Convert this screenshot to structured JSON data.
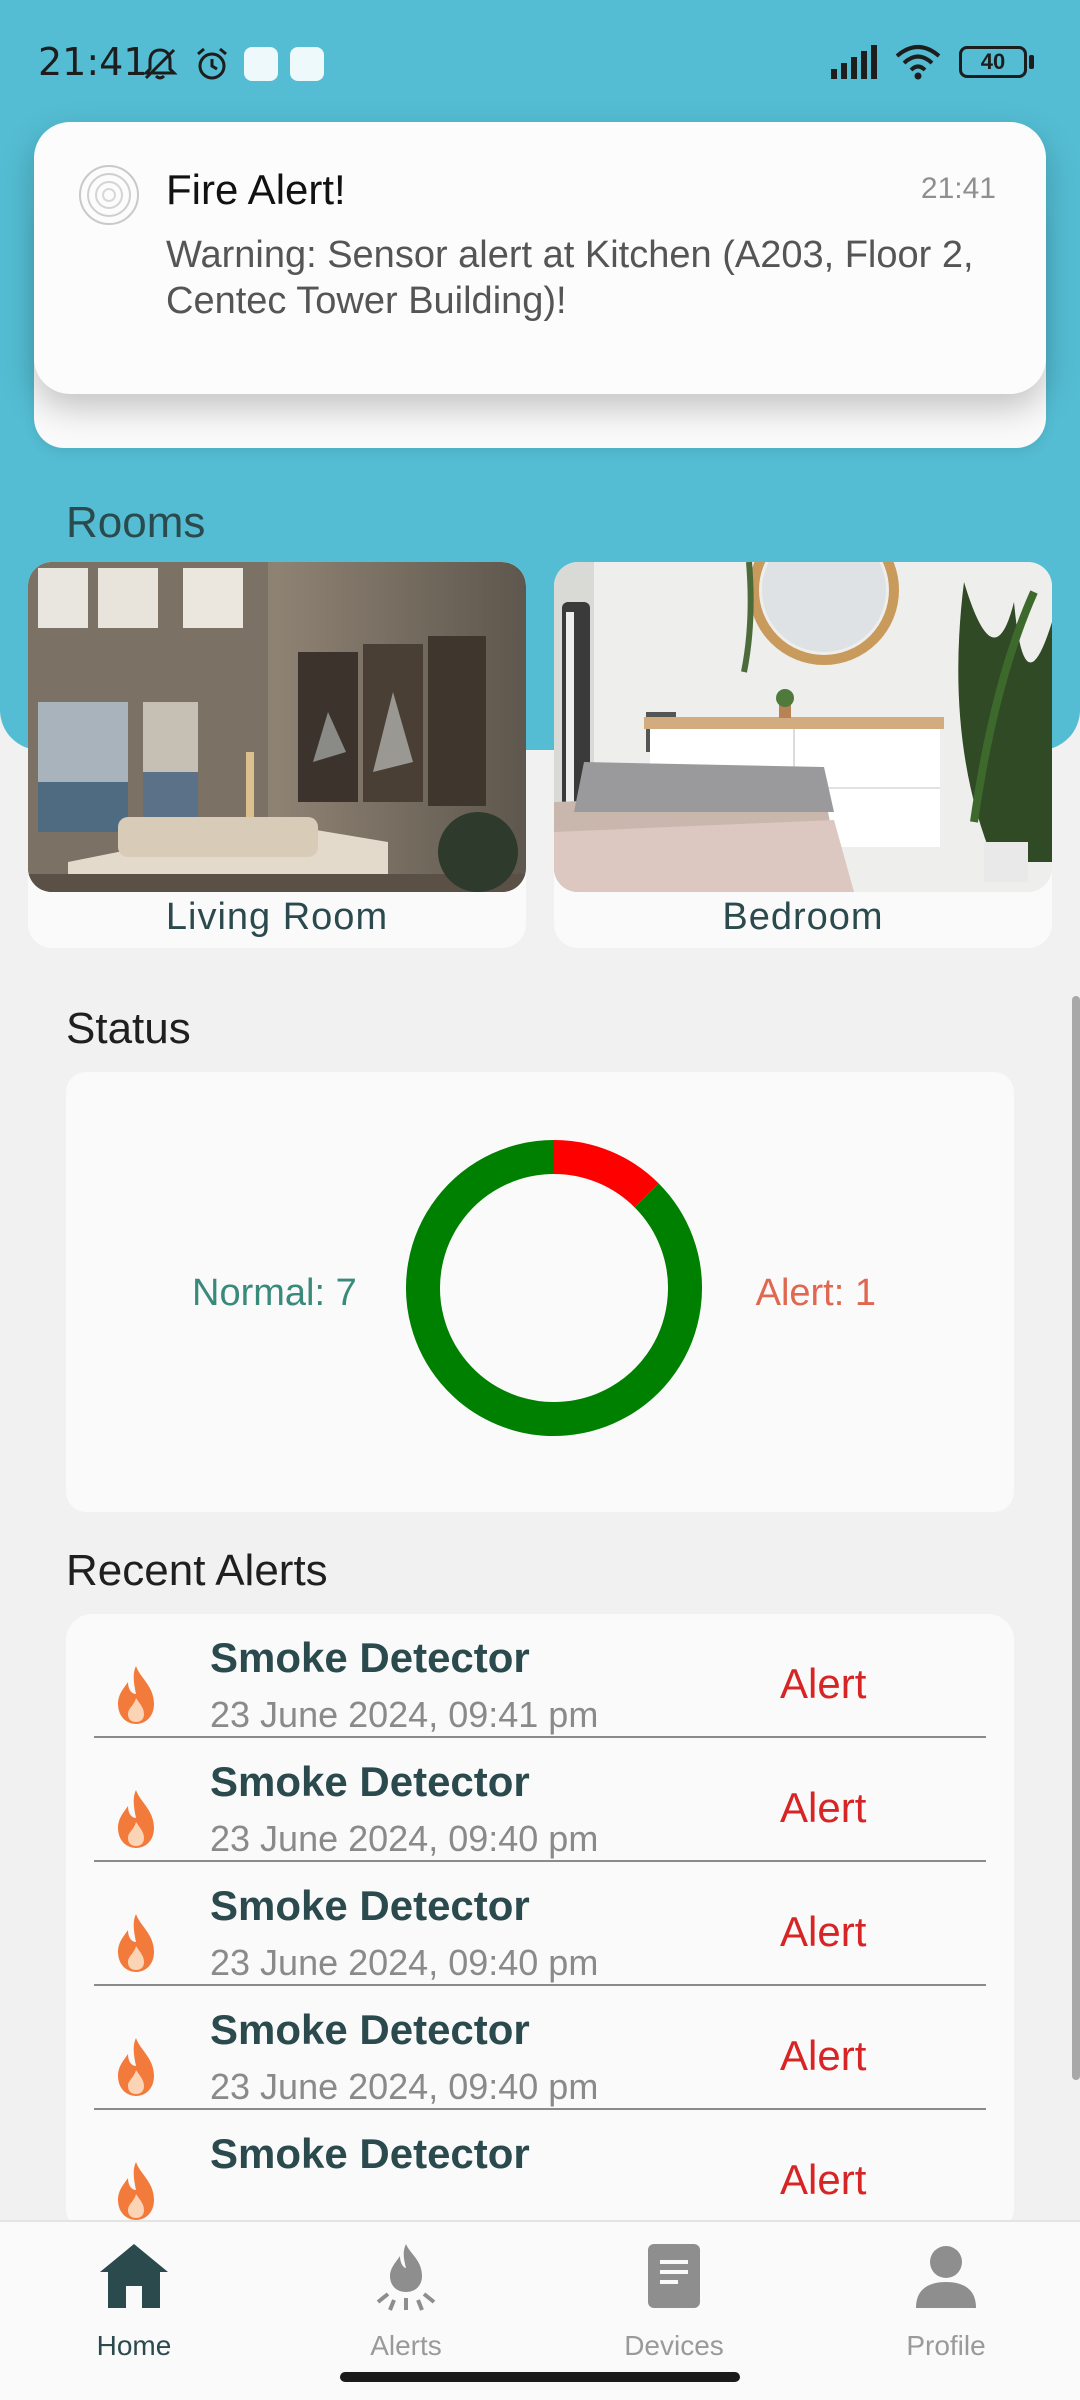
{
  "status_bar": {
    "time": "21:41",
    "battery": "40"
  },
  "notification": {
    "title": "Fire Alert!",
    "time": "21:41",
    "body": "Warning: Sensor alert at Kitchen (A203, Floor 2, Centec Tower Building)!"
  },
  "rooms": {
    "title": "Rooms",
    "items": [
      {
        "label": "Living Room"
      },
      {
        "label": "Bedroom"
      }
    ]
  },
  "status": {
    "title": "Status",
    "normal_label": "Normal: 7",
    "alert_label": "Alert: 1",
    "colors": {
      "normal": "#008000",
      "alert": "#ff0000"
    }
  },
  "chart_data": {
    "type": "pie",
    "categories": [
      "Normal",
      "Alert"
    ],
    "values": [
      7,
      1
    ],
    "title": ""
  },
  "recent_alerts": {
    "title": "Recent Alerts",
    "items": [
      {
        "name": "Smoke Detector",
        "date": "23 June 2024, 09:41 pm",
        "status": "Alert"
      },
      {
        "name": "Smoke Detector",
        "date": "23 June 2024, 09:40 pm",
        "status": "Alert"
      },
      {
        "name": "Smoke Detector",
        "date": "23 June 2024, 09:40 pm",
        "status": "Alert"
      },
      {
        "name": "Smoke Detector",
        "date": "23 June 2024, 09:40 pm",
        "status": "Alert"
      },
      {
        "name": "Smoke Detector",
        "date": "",
        "status": "Alert"
      }
    ]
  },
  "bottom_nav": {
    "items": [
      {
        "label": "Home",
        "icon": "home-icon"
      },
      {
        "label": "Alerts",
        "icon": "alerts-icon"
      },
      {
        "label": "Devices",
        "icon": "devices-icon"
      },
      {
        "label": "Profile",
        "icon": "profile-icon"
      }
    ]
  }
}
